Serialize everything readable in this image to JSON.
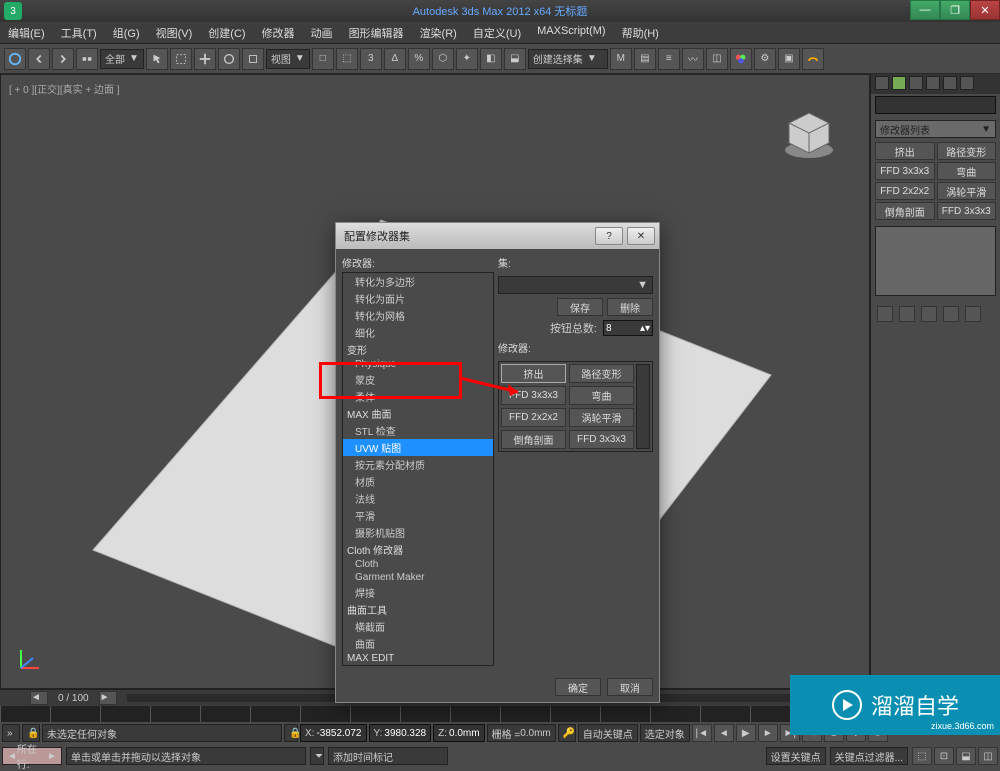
{
  "titlebar": {
    "title": "Autodesk 3ds Max 2012 x64   无标题",
    "min": "—",
    "max": "❐",
    "close": "✕"
  },
  "menubar": [
    "编辑(E)",
    "工具(T)",
    "组(G)",
    "视图(V)",
    "创建(C)",
    "修改器",
    "动画",
    "图形编辑器",
    "渲染(R)",
    "自定义(U)",
    "MAXScript(M)",
    "帮助(H)"
  ],
  "toolbar": {
    "dd_all": "全部",
    "dd_view": "视图",
    "dd_create": "创建选择集"
  },
  "viewport": {
    "label": "[ + 0 ][正交][真实 + 边面 ]"
  },
  "right_panel": {
    "dd": "修改器列表",
    "buttons": [
      "挤出",
      "路径变形",
      "FFD 3x3x3",
      "弯曲",
      "FFD 2x2x2",
      "涡轮平滑",
      "倒角剖面",
      "FFD 3x3x3"
    ]
  },
  "dialog": {
    "title": "配置修改器集",
    "help": "?",
    "close": "✕",
    "left_label": "修改器:",
    "set_label": "集:",
    "save": "保存",
    "delete": "删除",
    "count_label": "按钮总数:",
    "count_value": "8",
    "right_label": "修改器:",
    "ok": "确定",
    "cancel": "取消",
    "list": [
      {
        "text": "转化为多边形",
        "indent": 1
      },
      {
        "text": "转化为面片",
        "indent": 1
      },
      {
        "text": "转化为网格",
        "indent": 1
      },
      {
        "text": "细化",
        "indent": 1
      },
      {
        "text": "变形",
        "indent": 0,
        "header": true
      },
      {
        "text": "Physique",
        "indent": 1
      },
      {
        "text": "蒙皮",
        "indent": 1
      },
      {
        "text": "柔体",
        "indent": 1
      },
      {
        "text": "MAX 曲面",
        "indent": 0,
        "header": true
      },
      {
        "text": "STL 检查",
        "indent": 1
      },
      {
        "text": "UVW 贴图",
        "indent": 1,
        "selected": true
      },
      {
        "text": "按元素分配材质",
        "indent": 1
      },
      {
        "text": "材质",
        "indent": 1
      },
      {
        "text": "法线",
        "indent": 1
      },
      {
        "text": "平滑",
        "indent": 1
      },
      {
        "text": "摄影机贴图",
        "indent": 1
      },
      {
        "text": "Cloth 修改器",
        "indent": 0,
        "header": true
      },
      {
        "text": "Cloth",
        "indent": 1
      },
      {
        "text": "Garment Maker",
        "indent": 1
      },
      {
        "text": "焊接",
        "indent": 1
      },
      {
        "text": "曲面工具",
        "indent": 0,
        "header": true
      },
      {
        "text": "横截面",
        "indent": 1
      },
      {
        "text": "曲面",
        "indent": 1
      },
      {
        "text": "MAX EDIT",
        "indent": 0,
        "header": true
      }
    ],
    "grid": [
      "挤出",
      "路径变形",
      "FFD 3x3x3",
      "弯曲",
      "FFD 2x2x2",
      "涡轮平滑",
      "倒角剖面",
      "FFD 3x3x3"
    ]
  },
  "timeslider": {
    "pos": "0 / 100"
  },
  "status": {
    "msg1": "未选定任何对象",
    "msg2": "单击或单击并拖动以选择对象",
    "x_label": "X:",
    "x": "-3852.072",
    "y_label": "Y:",
    "y": "3980.328",
    "z_label": "Z:",
    "z": "0.0mm",
    "grid_label": "栅格 = ",
    "grid": "0.0mm",
    "autokey": "自动关键点",
    "selkey": "选定对象",
    "addtime": "添加时间标记",
    "setkey": "设置关键点",
    "keyfilter": "关键点过滤器...",
    "location": "所在行:"
  },
  "watermark": {
    "text": "溜溜自学",
    "url": "zixue.3d66.com"
  }
}
